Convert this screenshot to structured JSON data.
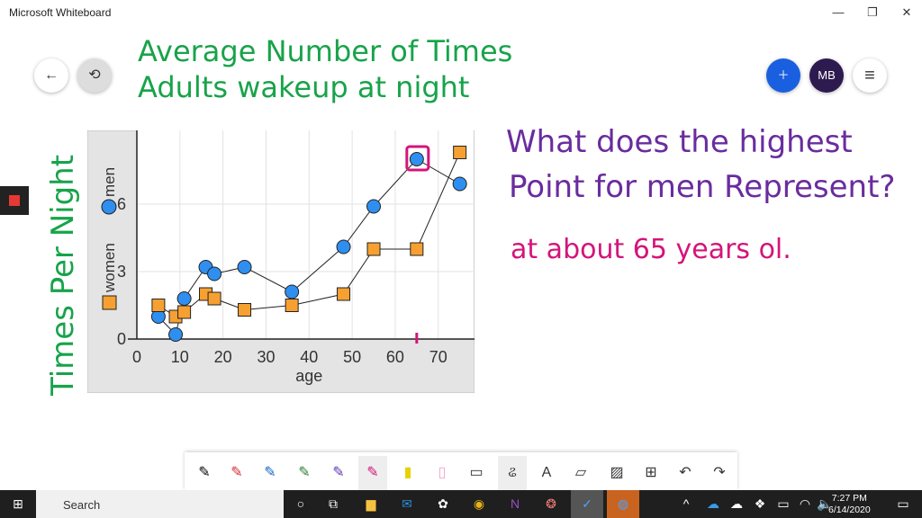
{
  "window": {
    "title": "Microsoft Whiteboard",
    "minimize": "—",
    "maximize": "❐",
    "close": "✕"
  },
  "header": {
    "back_icon": "←",
    "avatar_initials": "MB",
    "menu_icon": "≡",
    "invite_icon": "👤"
  },
  "notes": {
    "title_line1": "Average Number of Times",
    "title_line2": "Adults wakeup at night",
    "ylabel_hand": "Times Per Night",
    "question_line1": "What does the highest",
    "question_line2": "Point for men Represent?",
    "answer": "at about 65 years ol."
  },
  "colors": {
    "men": "#2f8ff0",
    "women": "#f7a032",
    "highlight": "#d4147a"
  },
  "chart_data": {
    "type": "scatter",
    "xlabel": "age",
    "ylabel": "",
    "legend": [
      {
        "name": "women",
        "marker": "square"
      },
      {
        "name": "men",
        "marker": "circle"
      }
    ],
    "xlim": [
      0,
      78
    ],
    "ylim": [
      0,
      9.2
    ],
    "xticks": [
      0,
      10,
      20,
      30,
      40,
      50,
      60,
      70
    ],
    "yticks": [
      0,
      3,
      6
    ],
    "grid": true,
    "series": [
      {
        "name": "men",
        "x": [
          5,
          9,
          11,
          16,
          18,
          25,
          36,
          48,
          55,
          65,
          75
        ],
        "y": [
          1,
          0.2,
          1.8,
          3.2,
          2.9,
          3.2,
          2.1,
          4.1,
          5.9,
          8,
          6.9
        ]
      },
      {
        "name": "women",
        "x": [
          5,
          9,
          11,
          16,
          18,
          25,
          36,
          48,
          55,
          65,
          75
        ],
        "y": [
          1.5,
          1,
          1.2,
          2,
          1.8,
          1.3,
          1.5,
          2,
          4,
          4,
          8.3
        ]
      }
    ]
  },
  "toolbar": {
    "text": "A",
    "undo": "↶",
    "redo": "↷",
    "add": "⊞"
  },
  "taskbar": {
    "search_label": "Search",
    "time": "7:27 PM",
    "date": "6/14/2020"
  }
}
